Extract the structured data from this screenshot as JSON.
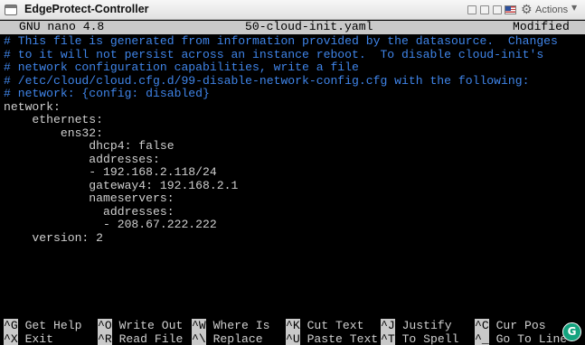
{
  "window": {
    "title": "EdgeProtect-Controller",
    "actions_label": "Actions",
    "icons": [
      "app-icon",
      "window-button-icon",
      "flag-icon",
      "gear-icon",
      "dropdown-icon"
    ]
  },
  "nano": {
    "version": "GNU nano 4.8",
    "filename": "50-cloud-init.yaml",
    "status": "Modified"
  },
  "file_lines": [
    {
      "text": "# This file is generated from information provided by the datasource.  Changes",
      "kind": "comment"
    },
    {
      "text": "# to it will not persist across an instance reboot.  To disable cloud-init's",
      "kind": "comment"
    },
    {
      "text": "# network configuration capabilities, write a file",
      "kind": "comment"
    },
    {
      "text": "# /etc/cloud/cloud.cfg.d/99-disable-network-config.cfg with the following:",
      "kind": "comment"
    },
    {
      "text": "# network: {config: disabled}",
      "kind": "comment"
    },
    {
      "text": "network:",
      "kind": "plain"
    },
    {
      "text": "    ethernets:",
      "kind": "plain"
    },
    {
      "text": "        ens32:",
      "kind": "plain"
    },
    {
      "text": "            dhcp4: false",
      "kind": "plain"
    },
    {
      "text": "            addresses:",
      "kind": "plain"
    },
    {
      "text": "            - 192.168.2.118/24",
      "kind": "plain"
    },
    {
      "text": "            gateway4: 192.168.2.1",
      "kind": "plain"
    },
    {
      "text": "            nameservers:",
      "kind": "plain"
    },
    {
      "text": "              addresses:",
      "kind": "plain"
    },
    {
      "text": "              - 208.67.222.222",
      "kind": "plain"
    },
    {
      "text": "    version: 2",
      "kind": "plain"
    }
  ],
  "shortcuts": [
    {
      "key": "^G",
      "label": "Get Help",
      "row": 0,
      "col": 0
    },
    {
      "key": "^O",
      "label": "Write Out",
      "row": 0,
      "col": 1
    },
    {
      "key": "^W",
      "label": "Where Is",
      "row": 0,
      "col": 2
    },
    {
      "key": "^K",
      "label": "Cut Text",
      "row": 0,
      "col": 3
    },
    {
      "key": "^J",
      "label": "Justify",
      "row": 0,
      "col": 4
    },
    {
      "key": "^C",
      "label": "Cur Pos",
      "row": 0,
      "col": 5
    },
    {
      "key": "^X",
      "label": "Exit",
      "row": 1,
      "col": 0
    },
    {
      "key": "^R",
      "label": "Read File",
      "row": 1,
      "col": 1
    },
    {
      "key": "^\\",
      "label": "Replace",
      "row": 1,
      "col": 2
    },
    {
      "key": "^U",
      "label": "Paste Text",
      "row": 1,
      "col": 3
    },
    {
      "key": "^T",
      "label": "To Spell",
      "row": 1,
      "col": 4
    },
    {
      "key": "^_",
      "label": "Go To Line",
      "row": 1,
      "col": 5
    }
  ],
  "grammarly": {
    "glyph": "G",
    "icon": "grammarly-icon"
  },
  "colors": {
    "terminal_bg": "#000000",
    "comment": "#3f84e8",
    "text": "#cfcfcf",
    "header_bg": "#c9c9c9",
    "grammarly": "#14a37f"
  }
}
